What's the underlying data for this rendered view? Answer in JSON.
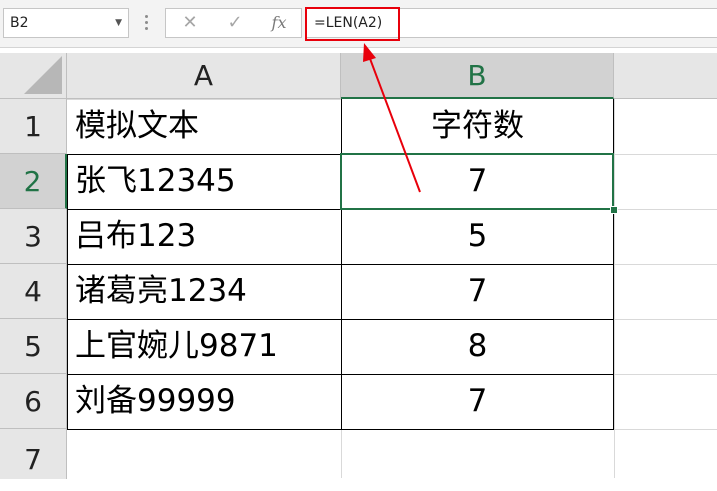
{
  "formula_bar": {
    "name_box": "B2",
    "name_box_dropdown_icon": "chevron-down-icon",
    "cancel_icon": "✕",
    "enter_icon": "✓",
    "fx_label": "fx",
    "formula": "=LEN(A2)"
  },
  "columns": [
    "A",
    "B"
  ],
  "rows": [
    "1",
    "2",
    "3",
    "4",
    "5",
    "6",
    "7"
  ],
  "selected_cell": "B2",
  "cells": [
    {
      "a": "模拟文本",
      "b": "字符数"
    },
    {
      "a": "张飞12345",
      "b": "7"
    },
    {
      "a": "吕布123",
      "b": "5"
    },
    {
      "a": "诸葛亮1234",
      "b": "7"
    },
    {
      "a": "上官婉儿9871",
      "b": "8"
    },
    {
      "a": "刘备99999",
      "b": "7"
    },
    {
      "a": "",
      "b": ""
    }
  ],
  "colors": {
    "annotation": "#e8000b",
    "selection": "#217346"
  }
}
